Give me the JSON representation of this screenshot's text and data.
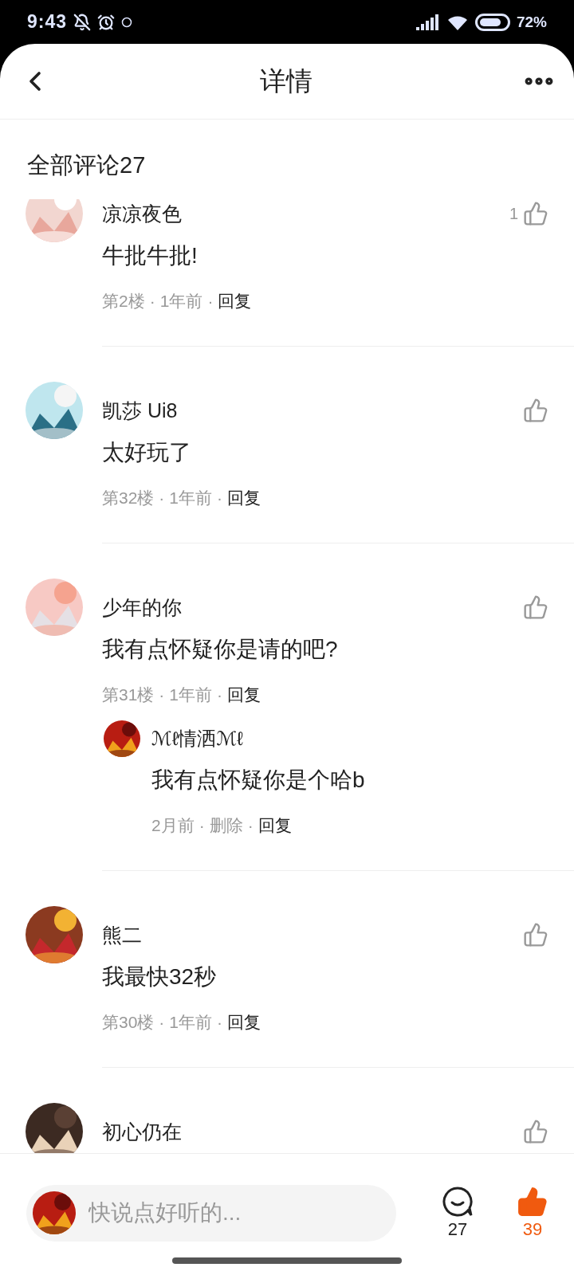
{
  "status_bar": {
    "time": "9:43",
    "battery": "72%"
  },
  "header": {
    "title": "详情"
  },
  "section_title": "全部评论27",
  "comments": [
    {
      "name": "凉凉夜色",
      "body": "牛批牛批!",
      "likes": "1",
      "liked": false,
      "meta": [
        {
          "kind": "info",
          "text": "第2楼"
        },
        {
          "kind": "info",
          "text": "1年前"
        },
        {
          "kind": "action",
          "text": "回复"
        }
      ]
    },
    {
      "name": "凯莎 Ui8",
      "body": "太好玩了",
      "liked": false,
      "meta": [
        {
          "kind": "info",
          "text": "第32楼"
        },
        {
          "kind": "info",
          "text": "1年前"
        },
        {
          "kind": "action",
          "text": "回复"
        }
      ]
    },
    {
      "name": "少年的你",
      "body": "我有点怀疑你是请的吧?",
      "liked": false,
      "meta": [
        {
          "kind": "info",
          "text": "第31楼"
        },
        {
          "kind": "info",
          "text": "1年前"
        },
        {
          "kind": "action",
          "text": "回复"
        }
      ],
      "replies": [
        {
          "name": "ℳℓ情洒ℳℓ",
          "body": "我有点怀疑你是个哈b",
          "meta": [
            {
              "kind": "info",
              "text": "2月前"
            },
            {
              "kind": "info",
              "text": "删除"
            },
            {
              "kind": "action",
              "text": "回复"
            }
          ]
        }
      ]
    },
    {
      "name": "熊二",
      "body": "我最快32秒",
      "liked": false,
      "meta": [
        {
          "kind": "info",
          "text": "第30楼"
        },
        {
          "kind": "info",
          "text": "1年前"
        },
        {
          "kind": "action",
          "text": "回复"
        }
      ]
    },
    {
      "name": "初心仍在",
      "liked": false
    }
  ],
  "separator": "·",
  "bottom_bar": {
    "placeholder": "快说点好听的...",
    "comment_count": "27",
    "like_count": "39",
    "liked": true
  }
}
